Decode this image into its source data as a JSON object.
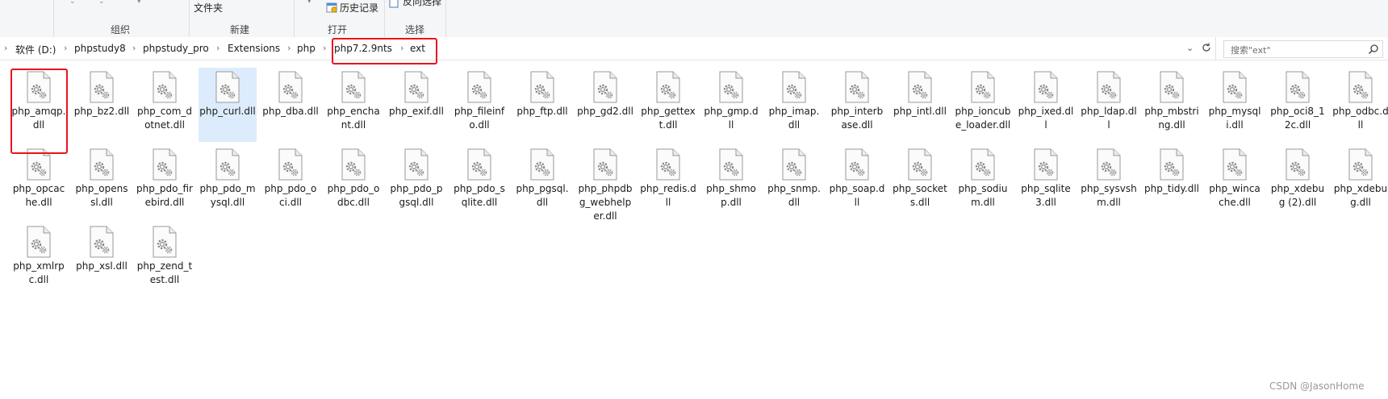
{
  "ribbon": {
    "groups": [
      {
        "name": "organize",
        "label": "组织"
      },
      {
        "name": "new",
        "label": "新建",
        "item": "文件夹"
      },
      {
        "name": "open",
        "label": "打开",
        "item": "历史记录"
      },
      {
        "name": "select",
        "label": "选择",
        "item": "反向选择"
      }
    ]
  },
  "address": {
    "crumbs": [
      "软件 (D:)",
      "phpstudy8",
      "phpstudy_pro",
      "Extensions",
      "php",
      "php7.2.9nts",
      "ext"
    ],
    "search_placeholder": "搜索\"ext\""
  },
  "files": [
    "php_amqp.dll",
    "php_bz2.dll",
    "php_com_dotnet.dll",
    "php_curl.dll",
    "php_dba.dll",
    "php_enchant.dll",
    "php_exif.dll",
    "php_fileinfo.dll",
    "php_ftp.dll",
    "php_gd2.dll",
    "php_gettext.dll",
    "php_gmp.dll",
    "php_imap.dll",
    "php_interbase.dll",
    "php_intl.dll",
    "php_ioncube_loader.dll",
    "php_ixed.dll",
    "php_ldap.dll",
    "php_mbstring.dll",
    "php_mysqli.dll",
    "php_oci8_12c.dll",
    "php_odbc.dll",
    "php_opcache.dll",
    "php_openssl.dll",
    "php_pdo_firebird.dll",
    "php_pdo_mysql.dll",
    "php_pdo_oci.dll",
    "php_pdo_odbc.dll",
    "php_pdo_pgsql.dll",
    "php_pdo_sqlite.dll",
    "php_pgsql.dll",
    "php_phpdbg_webhelper.dll",
    "php_redis.dll",
    "php_shmop.dll",
    "php_snmp.dll",
    "php_soap.dll",
    "php_sockets.dll",
    "php_sodium.dll",
    "php_sqlite3.dll",
    "php_sysvshm.dll",
    "php_tidy.dll",
    "php_wincache.dll",
    "php_xdebug (2).dll",
    "php_xdebug.dll",
    "php_xmlrpc.dll",
    "php_xsl.dll",
    "php_zend_test.dll"
  ],
  "selected_file": "php_curl.dll",
  "watermark": "CSDN @JasonHome",
  "colors": {
    "highlight": "#e8141e",
    "selection": "#dcecfc"
  }
}
